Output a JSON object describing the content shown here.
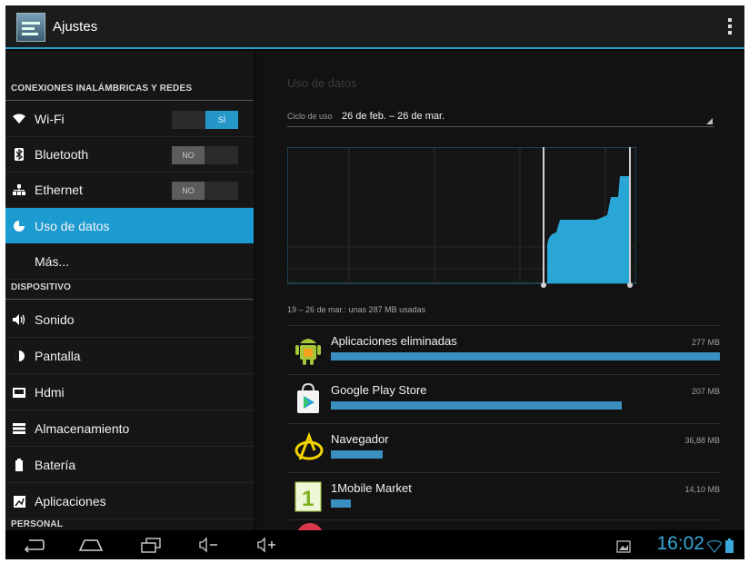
{
  "action_bar": {
    "title": "Ajustes"
  },
  "settings": {
    "section_wireless": "CONEXIONES INALÁMBRICAS Y REDES",
    "wifi": {
      "label": "Wi-Fi",
      "toggle": "SÍ"
    },
    "bluetooth": {
      "label": "Bluetooth",
      "toggle": "NO"
    },
    "ethernet": {
      "label": "Ethernet",
      "toggle": "NO"
    },
    "data_usage": {
      "label": "Uso de datos"
    },
    "more": {
      "label": "Más..."
    },
    "section_device": "DISPOSITIVO",
    "sound": {
      "label": "Sonido"
    },
    "display": {
      "label": "Pantalla"
    },
    "hdmi": {
      "label": "Hdmi"
    },
    "storage": {
      "label": "Almacenamiento"
    },
    "battery": {
      "label": "Batería"
    },
    "apps": {
      "label": "Aplicaciones"
    },
    "section_personal": "PERSONAL"
  },
  "data_usage": {
    "title": "Uso de datos",
    "cycle_label": "Ciclo de uso",
    "cycle_value": "26 de feb. – 26 de mar.",
    "usage_summary": "19 – 26 de mar.: unas 287 MB usadas",
    "apps": [
      {
        "name": "Aplicaciones eliminadas",
        "size": "277 MB",
        "fraction": 1.0,
        "icon": "android-icon"
      },
      {
        "name": "Google Play Store",
        "size": "207 MB",
        "fraction": 0.747,
        "icon": "play-store-icon"
      },
      {
        "name": "Navegador",
        "size": "36,88 MB",
        "fraction": 0.133,
        "icon": "browser-icon"
      },
      {
        "name": "1Mobile Market",
        "size": "14,10 MB",
        "fraction": 0.051,
        "icon": "1mobile-market-icon"
      }
    ]
  },
  "status": {
    "time": "16:02"
  },
  "colors": {
    "accent": "#1c9bd1",
    "graph_fill": "#29a6d6",
    "bar": "#3a8fc0"
  }
}
